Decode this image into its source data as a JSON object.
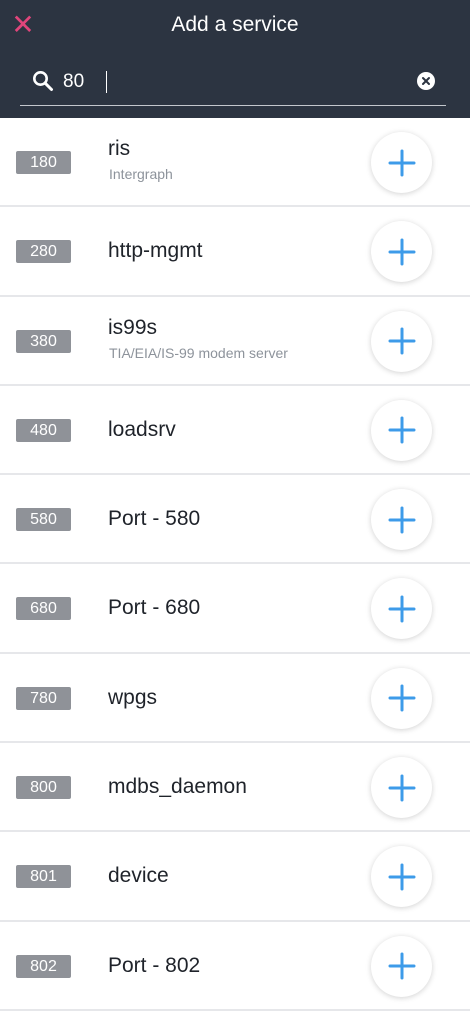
{
  "header": {
    "title": "Add a service",
    "close_icon": "close-icon",
    "accent_color": "#e0457b",
    "background_color": "#2c3441"
  },
  "search": {
    "value": "80",
    "search_icon": "search-icon",
    "clear_icon": "clear-circle-icon"
  },
  "services": [
    {
      "port": "180",
      "name": "ris",
      "description": "Intergraph"
    },
    {
      "port": "280",
      "name": "http-mgmt",
      "description": ""
    },
    {
      "port": "380",
      "name": "is99s",
      "description": "TIA/EIA/IS-99 modem server"
    },
    {
      "port": "480",
      "name": "loadsrv",
      "description": ""
    },
    {
      "port": "580",
      "name": "Port - 580",
      "description": ""
    },
    {
      "port": "680",
      "name": "Port - 680",
      "description": ""
    },
    {
      "port": "780",
      "name": "wpgs",
      "description": ""
    },
    {
      "port": "800",
      "name": "mdbs_daemon",
      "description": ""
    },
    {
      "port": "801",
      "name": "device",
      "description": ""
    },
    {
      "port": "802",
      "name": "Port - 802",
      "description": ""
    }
  ],
  "add_icon": "plus-icon",
  "add_color": "#3d9be9",
  "badge_color": "#8f9298"
}
